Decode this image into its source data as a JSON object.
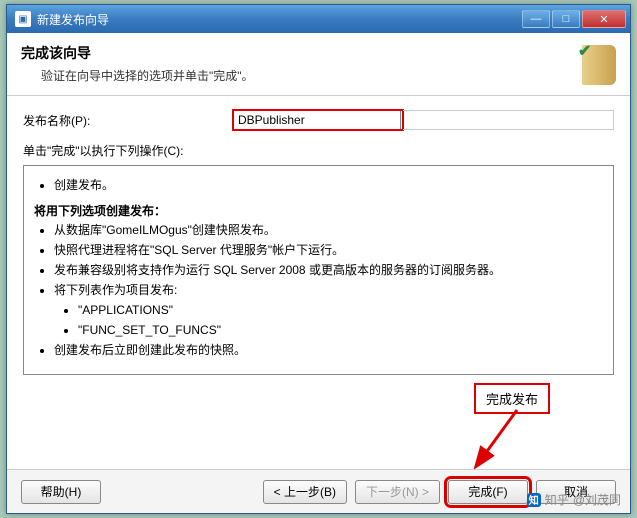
{
  "window": {
    "title": "新建发布向导",
    "min": "—",
    "max": "□",
    "close": "✕"
  },
  "header": {
    "title": "完成该向导",
    "subtitle": "验证在向导中选择的选项并单击\"完成\"。"
  },
  "form": {
    "publish_name_label": "发布名称(P):",
    "publish_name_value": "DBPublisher",
    "instruction": "单击\"完成\"以执行下列操作(C):"
  },
  "summary": {
    "line1": "创建发布。",
    "section_title": "将用下列选项创建发布：",
    "items": [
      "从数据库\"GomeILMOgus\"创建快照发布。",
      "快照代理进程将在\"SQL Server 代理服务\"帐户下运行。",
      "发布兼容级别将支持作为运行 SQL Server 2008 或更高版本的服务器的订阅服务器。",
      "将下列表作为项目发布:"
    ],
    "sub_items": [
      "\"APPLICATIONS\"",
      "\"FUNC_SET_TO_FUNCS\""
    ],
    "last": "创建发布后立即创建此发布的快照。"
  },
  "annotation": {
    "label": "完成发布"
  },
  "buttons": {
    "help": "帮助(H)",
    "back": "< 上一步(B)",
    "next": "下一步(N) >",
    "finish": "完成(F)",
    "cancel": "取消"
  },
  "watermark": {
    "site": "知乎",
    "user": "@刘茂同"
  }
}
